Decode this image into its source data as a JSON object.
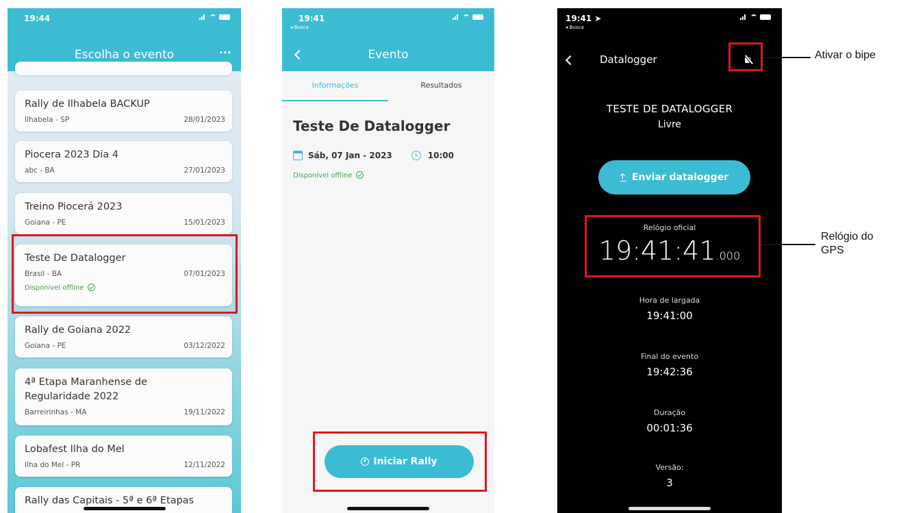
{
  "screen1": {
    "time": "19:44",
    "title": "Escolha o evento",
    "more": "···",
    "events": [
      {
        "name": "Rally de Ilhabela BACKUP",
        "place": "Ilhabela - SP",
        "date": "28/01/2023"
      },
      {
        "name": "Piocera 2023 Dia 4",
        "place": "abc - BA",
        "date": "27/01/2023"
      },
      {
        "name": "Treino Piocerá 2023",
        "place": "Goiana - PE",
        "date": "15/01/2023"
      },
      {
        "name": "Teste De Datalogger",
        "place": "Brasil - BA",
        "date": "07/01/2023",
        "offline": "Disponível offline"
      },
      {
        "name": "Rally de Goiana 2022",
        "place": "Goiana - PE",
        "date": "03/12/2022"
      },
      {
        "name": "4ª Etapa Maranhense de Regularidade 2022",
        "place": "Barreirinhas - MA",
        "date": "19/11/2022"
      },
      {
        "name": "Lobafest Ilha do Mel",
        "place": "Ilha do Mel  - PR",
        "date": "12/11/2022"
      },
      {
        "name": "Rally das Capitais - 5ª e 6ª Etapas",
        "place": "",
        "date": ""
      }
    ]
  },
  "screen2": {
    "time": "19:41",
    "back_app": "◂ Busca",
    "title": "Evento",
    "tabs": [
      "Informações",
      "Resultados"
    ],
    "event_title": "Teste De Datalogger",
    "date": "Sáb, 07 Jan - 2023",
    "time_value": "10:00",
    "offline": "Disponível offline",
    "start_button": "Iniciar Rally"
  },
  "screen3": {
    "time": "19:41 ➤",
    "back_app": "◂ Busca",
    "title": "Datalogger",
    "event_name": "TESTE DE DATALOGGER",
    "mode": "Livre",
    "send_button": "Enviar datalogger",
    "official_clock_label": "Relógio oficial",
    "official_clock_value": "19:41:41",
    "official_clock_ms": ".000",
    "start_label": "Hora de largada",
    "start_value": "19:41:00",
    "end_label": "Final do evento",
    "end_value": "19:42:36",
    "duration_label": "Duração",
    "duration_value": "00:01:36",
    "version_label": "Versão:",
    "version_value": "3"
  },
  "annotations": {
    "beep": "Ativar o bipe",
    "gps_clock": "Relógio do GPS"
  },
  "colors": {
    "accent": "#3cbcd3",
    "highlight": "#e0151b",
    "offline_green": "#3fa34d"
  }
}
